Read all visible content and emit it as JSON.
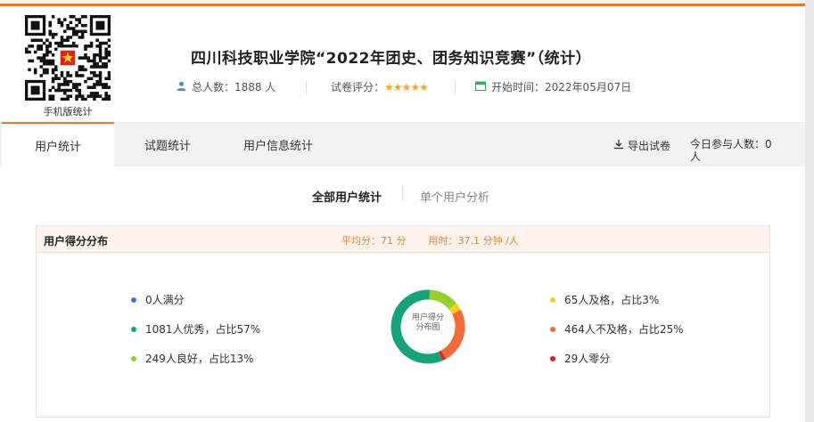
{
  "header": {
    "qr_caption": "手机版统计",
    "title": "四川科技职业学院“2022年团史、团务知识竞赛”（统计）",
    "total_people_label": "总人数：",
    "total_people_value": "1888 人",
    "rating_label": "试卷评分：",
    "rating_stars": "★★★★★",
    "start_time_label": "开始时间：",
    "start_time_value": "2022年05月07日"
  },
  "tabs": [
    {
      "label": "用户统计",
      "active": true
    },
    {
      "label": "试题统计",
      "active": false
    },
    {
      "label": "用户信息统计",
      "active": false
    }
  ],
  "toolbar": {
    "export_label": "导出试卷",
    "today_label": "今日参与人数：0 人"
  },
  "subtabs": [
    {
      "label": "全部用户统计",
      "active": true
    },
    {
      "label": "单个用户分析",
      "active": false
    }
  ],
  "panel": {
    "title": "用户得分分布",
    "avg_score": "平均分：71 分",
    "avg_time": "用时：37.1 分钟 /人",
    "donut_label_line1": "用户得分",
    "donut_label_line2": "分布图"
  },
  "chart_data": {
    "type": "pie",
    "categories": [
      "满分",
      "优秀",
      "良好",
      "及格",
      "不及格",
      "零分"
    ],
    "values": [
      0,
      1081,
      249,
      65,
      464,
      29
    ],
    "percentages": [
      0,
      57,
      13,
      3,
      25,
      2
    ],
    "legend": [
      {
        "text": "0人满分",
        "color": "#3a7bd5"
      },
      {
        "text": "1081人优秀，占比57%",
        "color": "#17a37a"
      },
      {
        "text": "249人良好，占比13%",
        "color": "#9acd32"
      },
      {
        "text": "65人及格，占比3%",
        "color": "#f5d020"
      },
      {
        "text": "464人不及格，占比25%",
        "color": "#f06a3a"
      },
      {
        "text": "29人零分",
        "color": "#e02020"
      }
    ]
  },
  "colors": {
    "accent": "#f0782a",
    "star": "#f5a623"
  }
}
